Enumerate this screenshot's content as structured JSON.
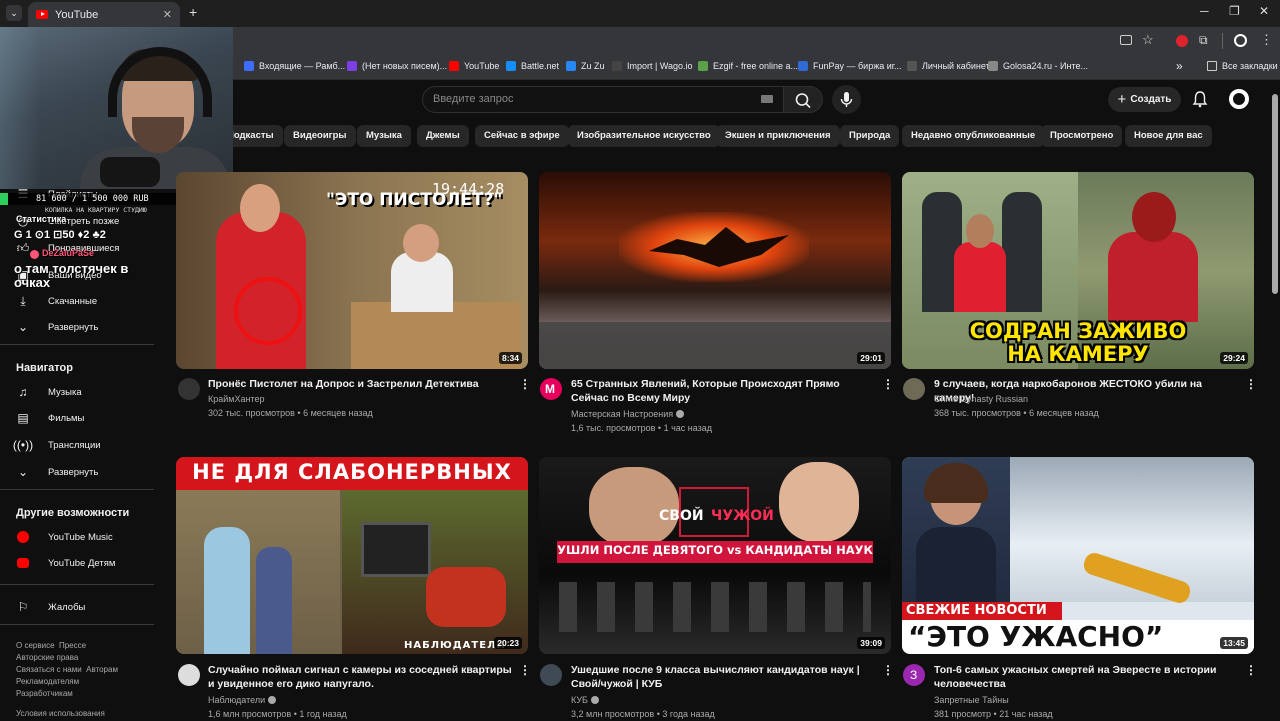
{
  "browser": {
    "tab_title": "YouTube",
    "tab_close": "✕",
    "new_tab": "+",
    "bookmarks": [
      {
        "label": "Входящие — Рамб...",
        "color": "#3d6cff"
      },
      {
        "label": "(Нет новых писем)...",
        "color": "#7b3fe4"
      },
      {
        "label": "YouTube",
        "color": "#ff0000"
      },
      {
        "label": "Battle.net",
        "color": "#148eff"
      },
      {
        "label": "Zu Zu",
        "color": "#2787f5"
      },
      {
        "label": "Import | Wago.io",
        "color": "#444444"
      },
      {
        "label": "Ezgif - free online a...",
        "color": "#5aa14a"
      },
      {
        "label": "FunPay — биржа иг...",
        "color": "#2f6ad6"
      },
      {
        "label": "Личный кабинет",
        "color": "#555555"
      },
      {
        "label": "Golosa24.ru - Инте...",
        "color": "#888888"
      }
    ],
    "more_bookmarks": "»",
    "all_bookmarks": "Все закладки"
  },
  "header": {
    "search_placeholder": "Введите запрос",
    "create_label": "Создать"
  },
  "chips": [
    "Подкасты",
    "Видеоигры",
    "Музыка",
    "Джемы",
    "Сейчас в эфире",
    "Изобразительное искусство",
    "Экшен и приключения",
    "Природа",
    "Недавно опубликованные",
    "Просмотрено",
    "Новое для вас"
  ],
  "sidebar": {
    "top_items": [
      "Плейлисты",
      "Смотреть позже",
      "Понравившиеся",
      "Ваши видео",
      "Скачанные",
      "Развернуть"
    ],
    "navigator_heading": "Навигатор",
    "navigator_items": [
      "Музыка",
      "Фильмы",
      "Трансляции",
      "Развернуть"
    ],
    "more_heading": "Другие возможности",
    "more_items": [
      "YouTube Music",
      "YouTube Детям"
    ],
    "report": "Жалобы",
    "footer1": [
      "О сервисе",
      "Прессе"
    ],
    "footer2": [
      "Авторские права"
    ],
    "footer3": [
      "Связаться с нами",
      "Авторам"
    ],
    "footer4": [
      "Рекламодателям"
    ],
    "footer5": [
      "Разработчикам"
    ],
    "footer6": [
      "Условия использования"
    ]
  },
  "overlay": {
    "goal": "81 600 / 1 500 000 RUB",
    "goal_caption": "КОПИЛКА НА КВАРТИРУ СТУДИЮ",
    "stats_label": "Статистика",
    "stats": "G 1  ⊙1  ⊡50  ♦2  ♣2",
    "nick": "DeZaluPaSe",
    "message": "о там толстячек в очках"
  },
  "videos": [
    {
      "title": "Пронёс Пистолет на Допрос и Застрелил Детектива",
      "channel": "КраймХантер",
      "views": "302 тыс. просмотров",
      "age": "6 месяцев назад",
      "duration": "8:34",
      "overlay_text": "\"ЭТО ПИСТОЛЕТ?\"",
      "clock": "19:44:28",
      "verified": false
    },
    {
      "title": "65 Странных Явлений, Которые Происходят Прямо Сейчас по Всему Миру",
      "channel": "Мастерская Настроения",
      "views": "1,6 тыс. просмотров",
      "age": "1 час назад",
      "duration": "29:01",
      "verified": true
    },
    {
      "title": "9 случаев, когда наркобаронов ЖЕСТОКО убили на камеру!",
      "channel": "Crime Dynasty Russian",
      "views": "368 тыс. просмотров",
      "age": "6 месяцев назад",
      "duration": "29:24",
      "overlay_text": "СОДРАН ЗАЖИВО\nНА КАМЕРУ",
      "verified": false
    },
    {
      "title": "Случайно поймал сигнал с камеры из соседней квартиры и увиденное его дико напугало.",
      "channel": "Наблюдатели",
      "views": "1,6 млн просмотров",
      "age": "1 год назад",
      "duration": "20:23",
      "overlay_text": "НЕ ДЛЯ СЛАБОНЕРВНЫХ",
      "overlay_small": "НАБЛЮДАТЕЛИ",
      "verified": true
    },
    {
      "title": "Ушедшие после 9 класса вычисляют кандидатов наук | Свой/чужой | КУБ",
      "channel": "КУБ",
      "views": "3,2 млн просмотров",
      "age": "3 года назад",
      "duration": "39:09",
      "overlay_text": "УШЛИ ПОСЛЕ ДЕВЯТОГО vs КАНДИДАТЫ НАУК",
      "overlay_logo_a": "СВОЙ",
      "overlay_logo_b": "ЧУЖОЙ",
      "verified": true
    },
    {
      "title": "Топ-6 самых ужасных смертей на Эвересте в истории человечества",
      "channel": "Запретные Тайны",
      "views": "381 просмотр",
      "age": "21 час назад",
      "duration": "13:45",
      "overlay_text": "СВЕЖИЕ НОВОСТИ",
      "overlay_big": "“ЭТО УЖАСНО”",
      "avatar_letter": "З",
      "verified": false
    }
  ],
  "colors": {
    "accent": "#ff0000",
    "bg": "#0f0f0f",
    "chip": "#272727"
  }
}
